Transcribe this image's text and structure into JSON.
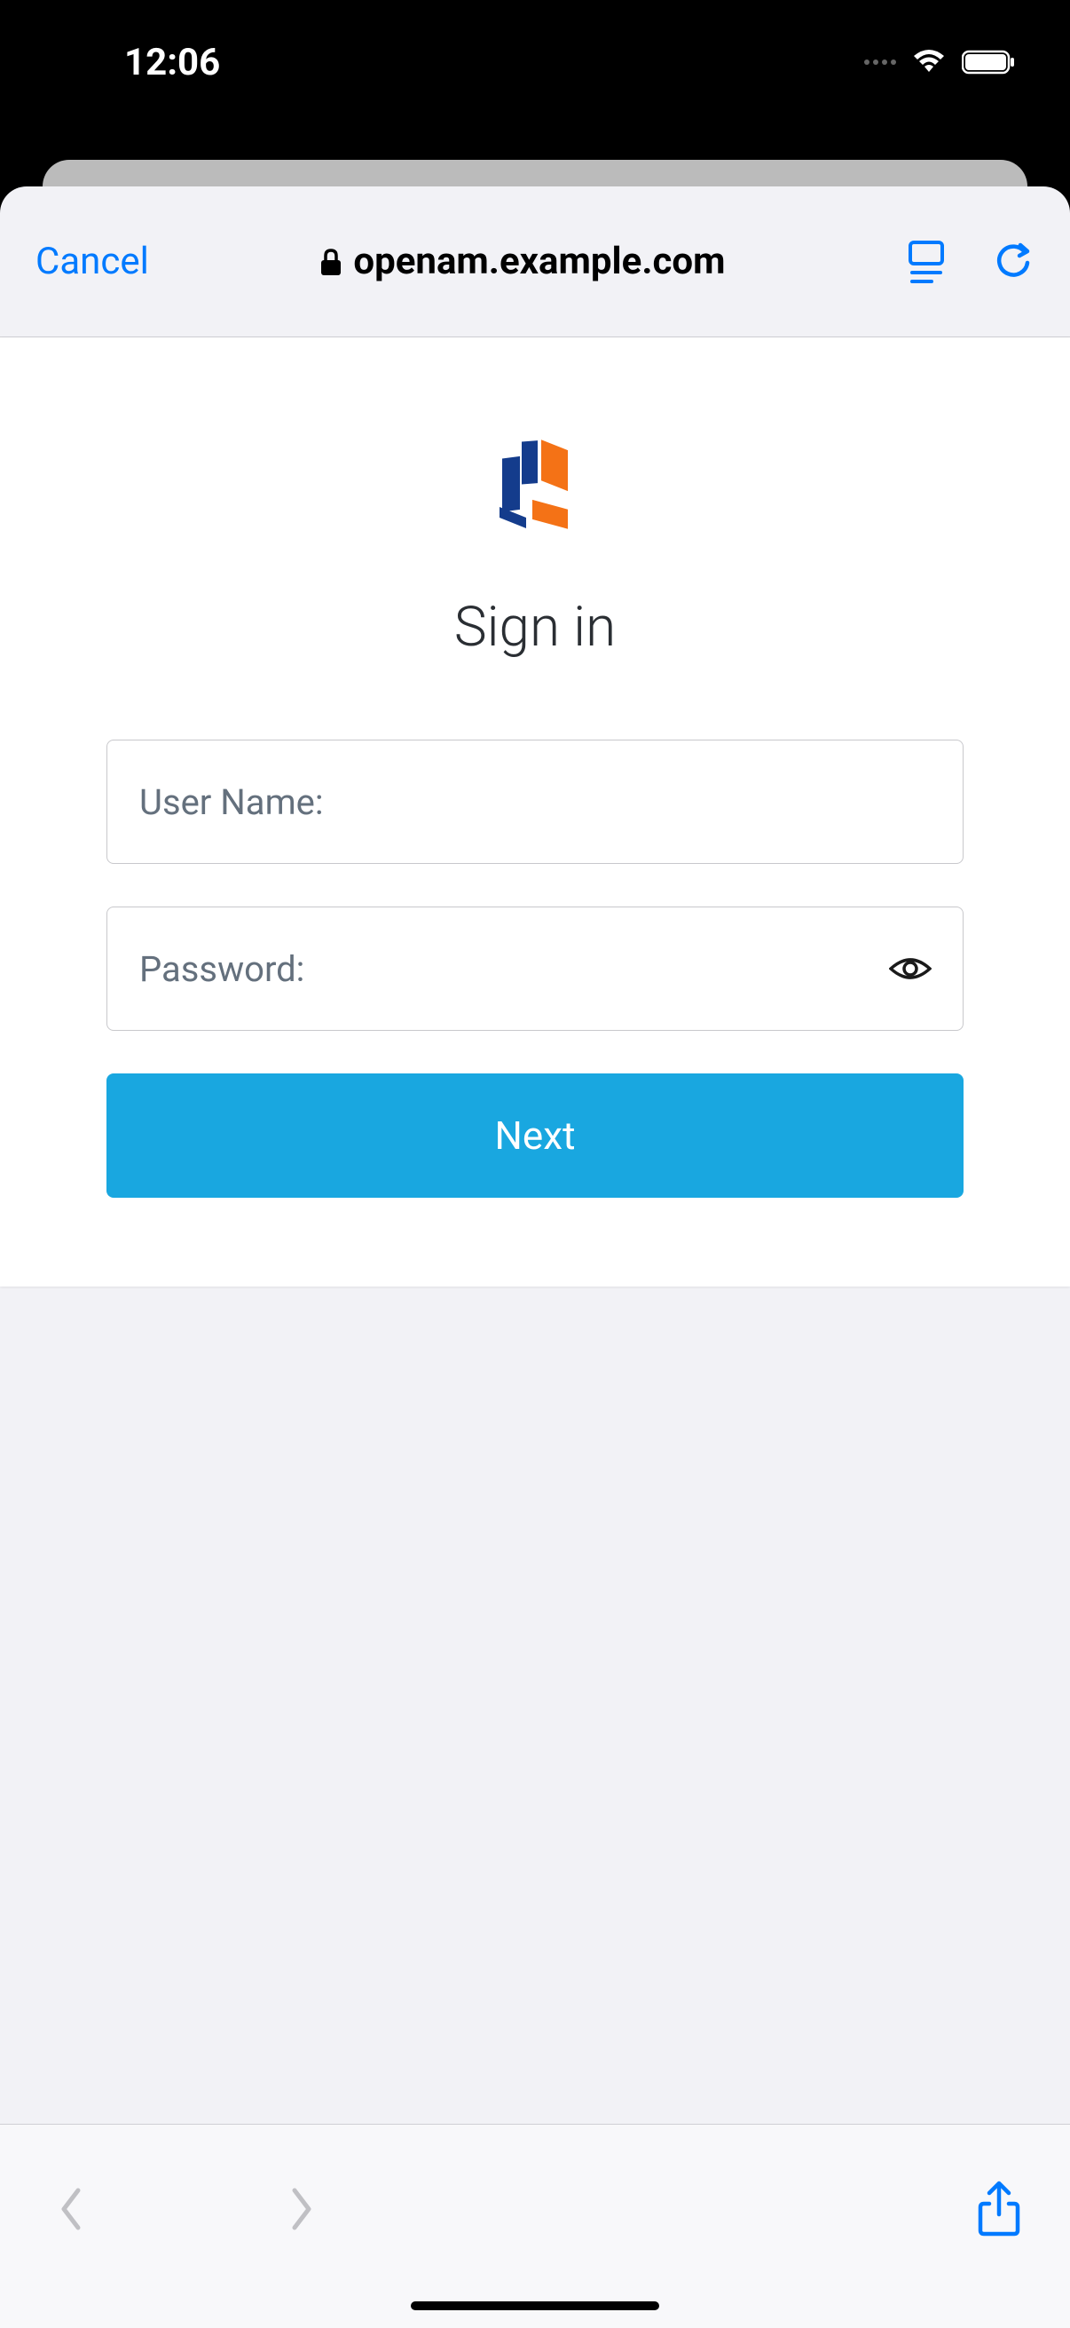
{
  "status": {
    "time": "12:06"
  },
  "browser": {
    "cancel": "Cancel",
    "url": "openam.example.com"
  },
  "signin": {
    "title": "Sign in",
    "username_placeholder": "User Name:",
    "password_placeholder": "Password:",
    "next_button": "Next"
  }
}
